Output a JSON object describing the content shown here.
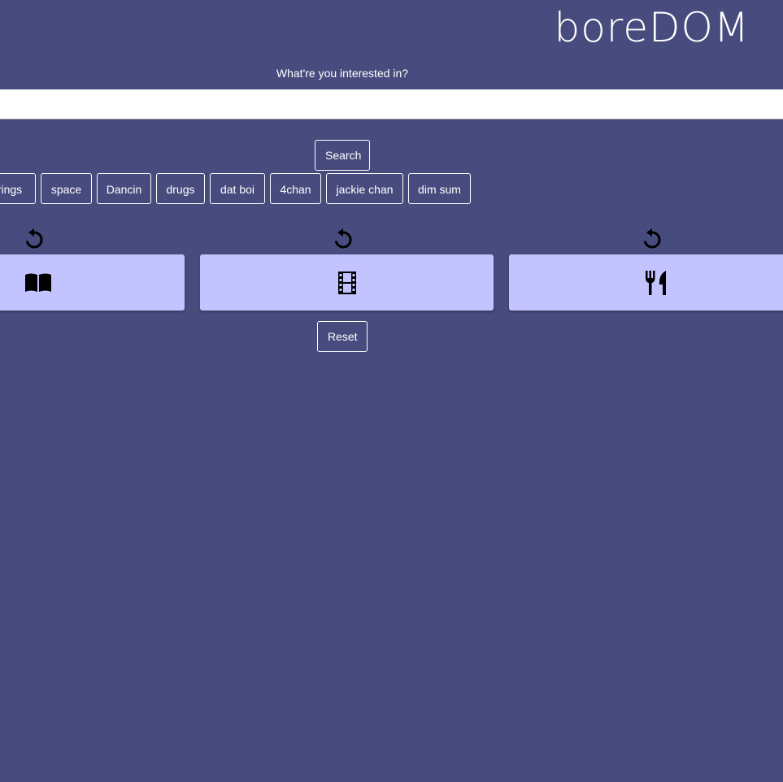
{
  "header": {
    "brand": "boreDOM"
  },
  "search": {
    "prompt": "What're you interested in?",
    "value": "",
    "placeholder": "",
    "button_label": "Search"
  },
  "suggestions": [
    "rings",
    "space",
    "Dancin",
    "drugs",
    "dat boi",
    "4chan",
    "jackie chan",
    "dim sum"
  ],
  "cards": [
    {
      "icon": "book-icon",
      "refresh_icon": "refresh-icon"
    },
    {
      "icon": "film-icon",
      "refresh_icon": "refresh-icon"
    },
    {
      "icon": "utensils-icon",
      "refresh_icon": "refresh-icon"
    }
  ],
  "reset": {
    "label": "Reset"
  },
  "colors": {
    "background": "#484b7d",
    "card": "#c3c4ff",
    "text": "#ffffff"
  }
}
